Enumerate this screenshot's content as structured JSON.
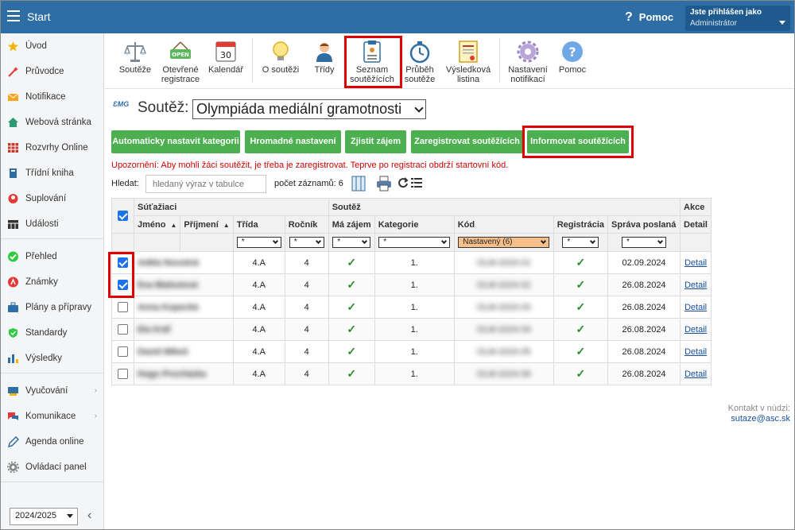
{
  "topbar": {
    "title": "Start",
    "help": "Pomoc",
    "user_line1": "Jste přihlášen jako",
    "user_line2": "Administrátor"
  },
  "sidebar": {
    "items": [
      {
        "label": "Úvod",
        "icon": "star-icon",
        "color": "#f4b400"
      },
      {
        "label": "Průvodce",
        "icon": "wand-icon",
        "color": "#e53935"
      },
      {
        "label": "Notifikace",
        "icon": "envelope-icon",
        "color": "#f5a623"
      },
      {
        "label": "Webová stránka",
        "icon": "home-icon",
        "color": "#2e9b6e"
      },
      {
        "label": "Rozvrhy Online",
        "icon": "grid-icon",
        "color": "#c0392b"
      },
      {
        "label": "Třídní kniha",
        "icon": "book-icon",
        "color": "#2f6ea5"
      },
      {
        "label": "Suplování",
        "icon": "person-icon",
        "color": "#e53935"
      },
      {
        "label": "Události",
        "icon": "calendar-icon",
        "color": "#333333"
      },
      {
        "label": "Přehled",
        "icon": "check-circle-icon",
        "color": "#2ecc40"
      },
      {
        "label": "Známky",
        "icon": "grade-icon",
        "color": "#e53935"
      },
      {
        "label": "Plány a přípravy",
        "icon": "briefcase-icon",
        "color": "#2f6ea5"
      },
      {
        "label": "Standardy",
        "icon": "shield-icon",
        "color": "#2ecc40"
      },
      {
        "label": "Výsledky",
        "icon": "bar-chart-icon",
        "color": "#2f6ea5"
      },
      {
        "label": "Vyučování",
        "icon": "board-icon",
        "color": "#2f6ea5"
      },
      {
        "label": "Komunikace",
        "icon": "chat-icon",
        "color": "#e53935"
      },
      {
        "label": "Agenda online",
        "icon": "pen-icon",
        "color": "#2f6ea5"
      },
      {
        "label": "Ovládací panel",
        "icon": "gear-icon",
        "color": "#888888"
      }
    ],
    "year": "2024/2025"
  },
  "toolbar": {
    "tools": [
      {
        "label1": "Soutěže",
        "label2": ""
      },
      {
        "label1": "Otevřené",
        "label2": "registrace"
      },
      {
        "label1": "Kalendář",
        "label2": ""
      },
      {
        "label1": "O soutěži",
        "label2": ""
      },
      {
        "label1": "Třídy",
        "label2": ""
      },
      {
        "label1": "Seznam",
        "label2": "soutěžících"
      },
      {
        "label1": "Průběh",
        "label2": "soutěže"
      },
      {
        "label1": "Výsledková",
        "label2": "listina"
      },
      {
        "label1": "Nastavení",
        "label2": "notifikací"
      },
      {
        "label1": "Pomoc",
        "label2": ""
      }
    ],
    "open_badge": "OPEN",
    "calendar_day": "30"
  },
  "content": {
    "logo": "ƐMG",
    "competition_label": "Soutěž:",
    "competition_value": "Olympiáda mediální gramotnosti",
    "buttons": [
      "Automaticky nastavit kategorii",
      "Hromadné nastavení",
      "Zjistit zájem",
      "Zaregistrovat soutěžících",
      "Informovat soutěžících"
    ],
    "warning": "Upozornění: Aby mohli žáci soutěžit, je třeba je zaregistrovat. Teprve po registraci obdrží startovní kód.",
    "search_label": "Hledat:",
    "search_placeholder": "hledaný výraz v tabulce",
    "count_label": "počet záznamů: 6"
  },
  "table": {
    "group_headers": {
      "students": "Súťažiaci",
      "competition": "Soutěž",
      "actions": "Akce"
    },
    "columns": [
      "Jméno",
      "Příjmení",
      "Třída",
      "Ročník",
      "Má zájem",
      "Kategorie",
      "Kód",
      "Registrácia",
      "Správa poslaná",
      "Detail"
    ],
    "filters": {
      "default": "*",
      "code": "Nastavený (6)"
    },
    "check_mark": "✓",
    "rows": [
      {
        "checked": true,
        "name": "Adéla Novotná",
        "class": "4.A",
        "grade": "4",
        "category": "1.",
        "code": "OLM-2024-01",
        "sent": "02.09.2024",
        "detail": "Detail"
      },
      {
        "checked": true,
        "name": "Eva Blahutová",
        "class": "4.A",
        "grade": "4",
        "category": "1.",
        "code": "OLM-2024-02",
        "sent": "26.08.2024",
        "detail": "Detail"
      },
      {
        "checked": false,
        "name": "Anna Kopecká",
        "class": "4.A",
        "grade": "4",
        "category": "1.",
        "code": "OLM-2024-03",
        "sent": "26.08.2024",
        "detail": "Detail"
      },
      {
        "checked": false,
        "name": "Ela Kráľ",
        "class": "4.A",
        "grade": "4",
        "category": "1.",
        "code": "OLM-2024-04",
        "sent": "26.08.2024",
        "detail": "Detail"
      },
      {
        "checked": false,
        "name": "David Mikeš",
        "class": "4.A",
        "grade": "4",
        "category": "1.",
        "code": "OLM-2024-05",
        "sent": "26.08.2024",
        "detail": "Detail"
      },
      {
        "checked": false,
        "name": "Hugo Procházka",
        "class": "4.A",
        "grade": "4",
        "category": "1.",
        "code": "OLM-2024-06",
        "sent": "26.08.2024",
        "detail": "Detail"
      }
    ]
  },
  "contact": {
    "label": "Kontakt v núdzi:",
    "email": "sutaze@asc.sk"
  }
}
